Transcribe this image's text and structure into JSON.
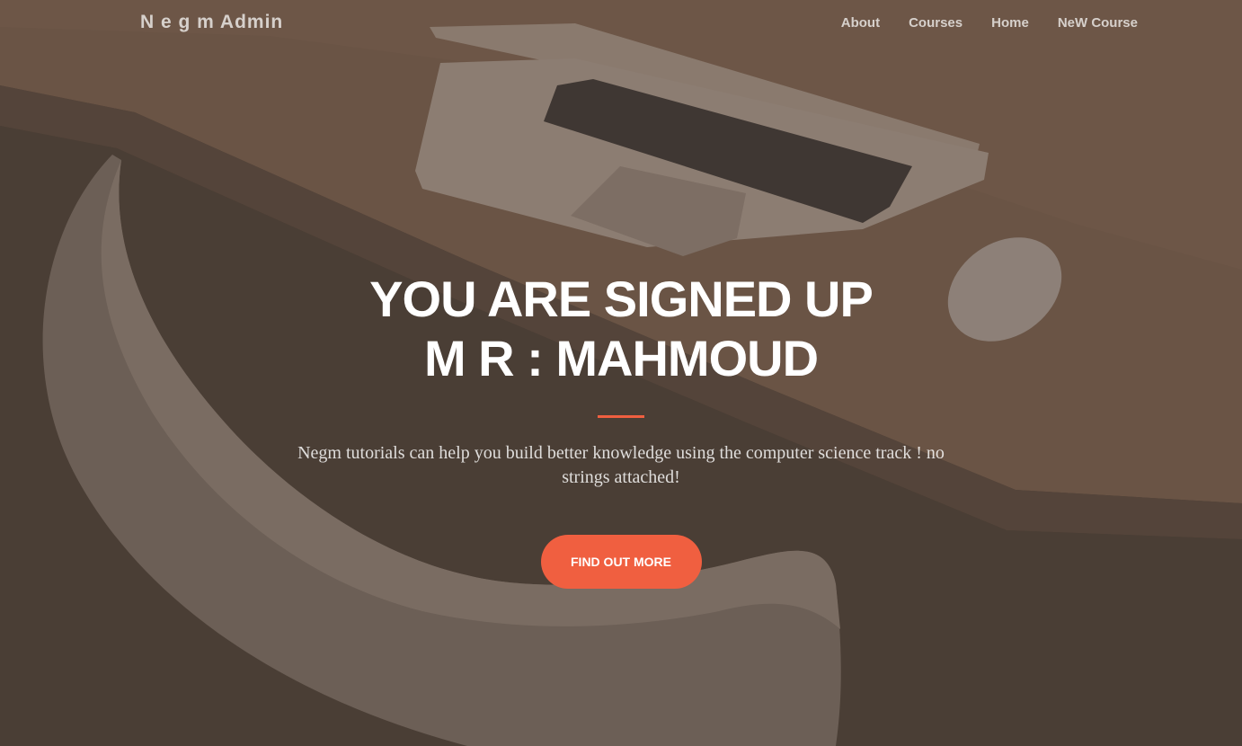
{
  "navbar": {
    "brand": "N e g m Admin",
    "links": [
      "About",
      "Courses",
      "Home",
      "NeW Course"
    ]
  },
  "hero": {
    "headline_line1": "YOU ARE SIGNED UP",
    "headline_line2": "M R : MAHMOUD",
    "lead": "Negm tutorials can help you build better knowledge using the computer science track ! no strings attached!",
    "cta_label": "FIND OUT MORE"
  },
  "colors": {
    "accent": "#f05f40",
    "overlay": "#4a3d33"
  }
}
